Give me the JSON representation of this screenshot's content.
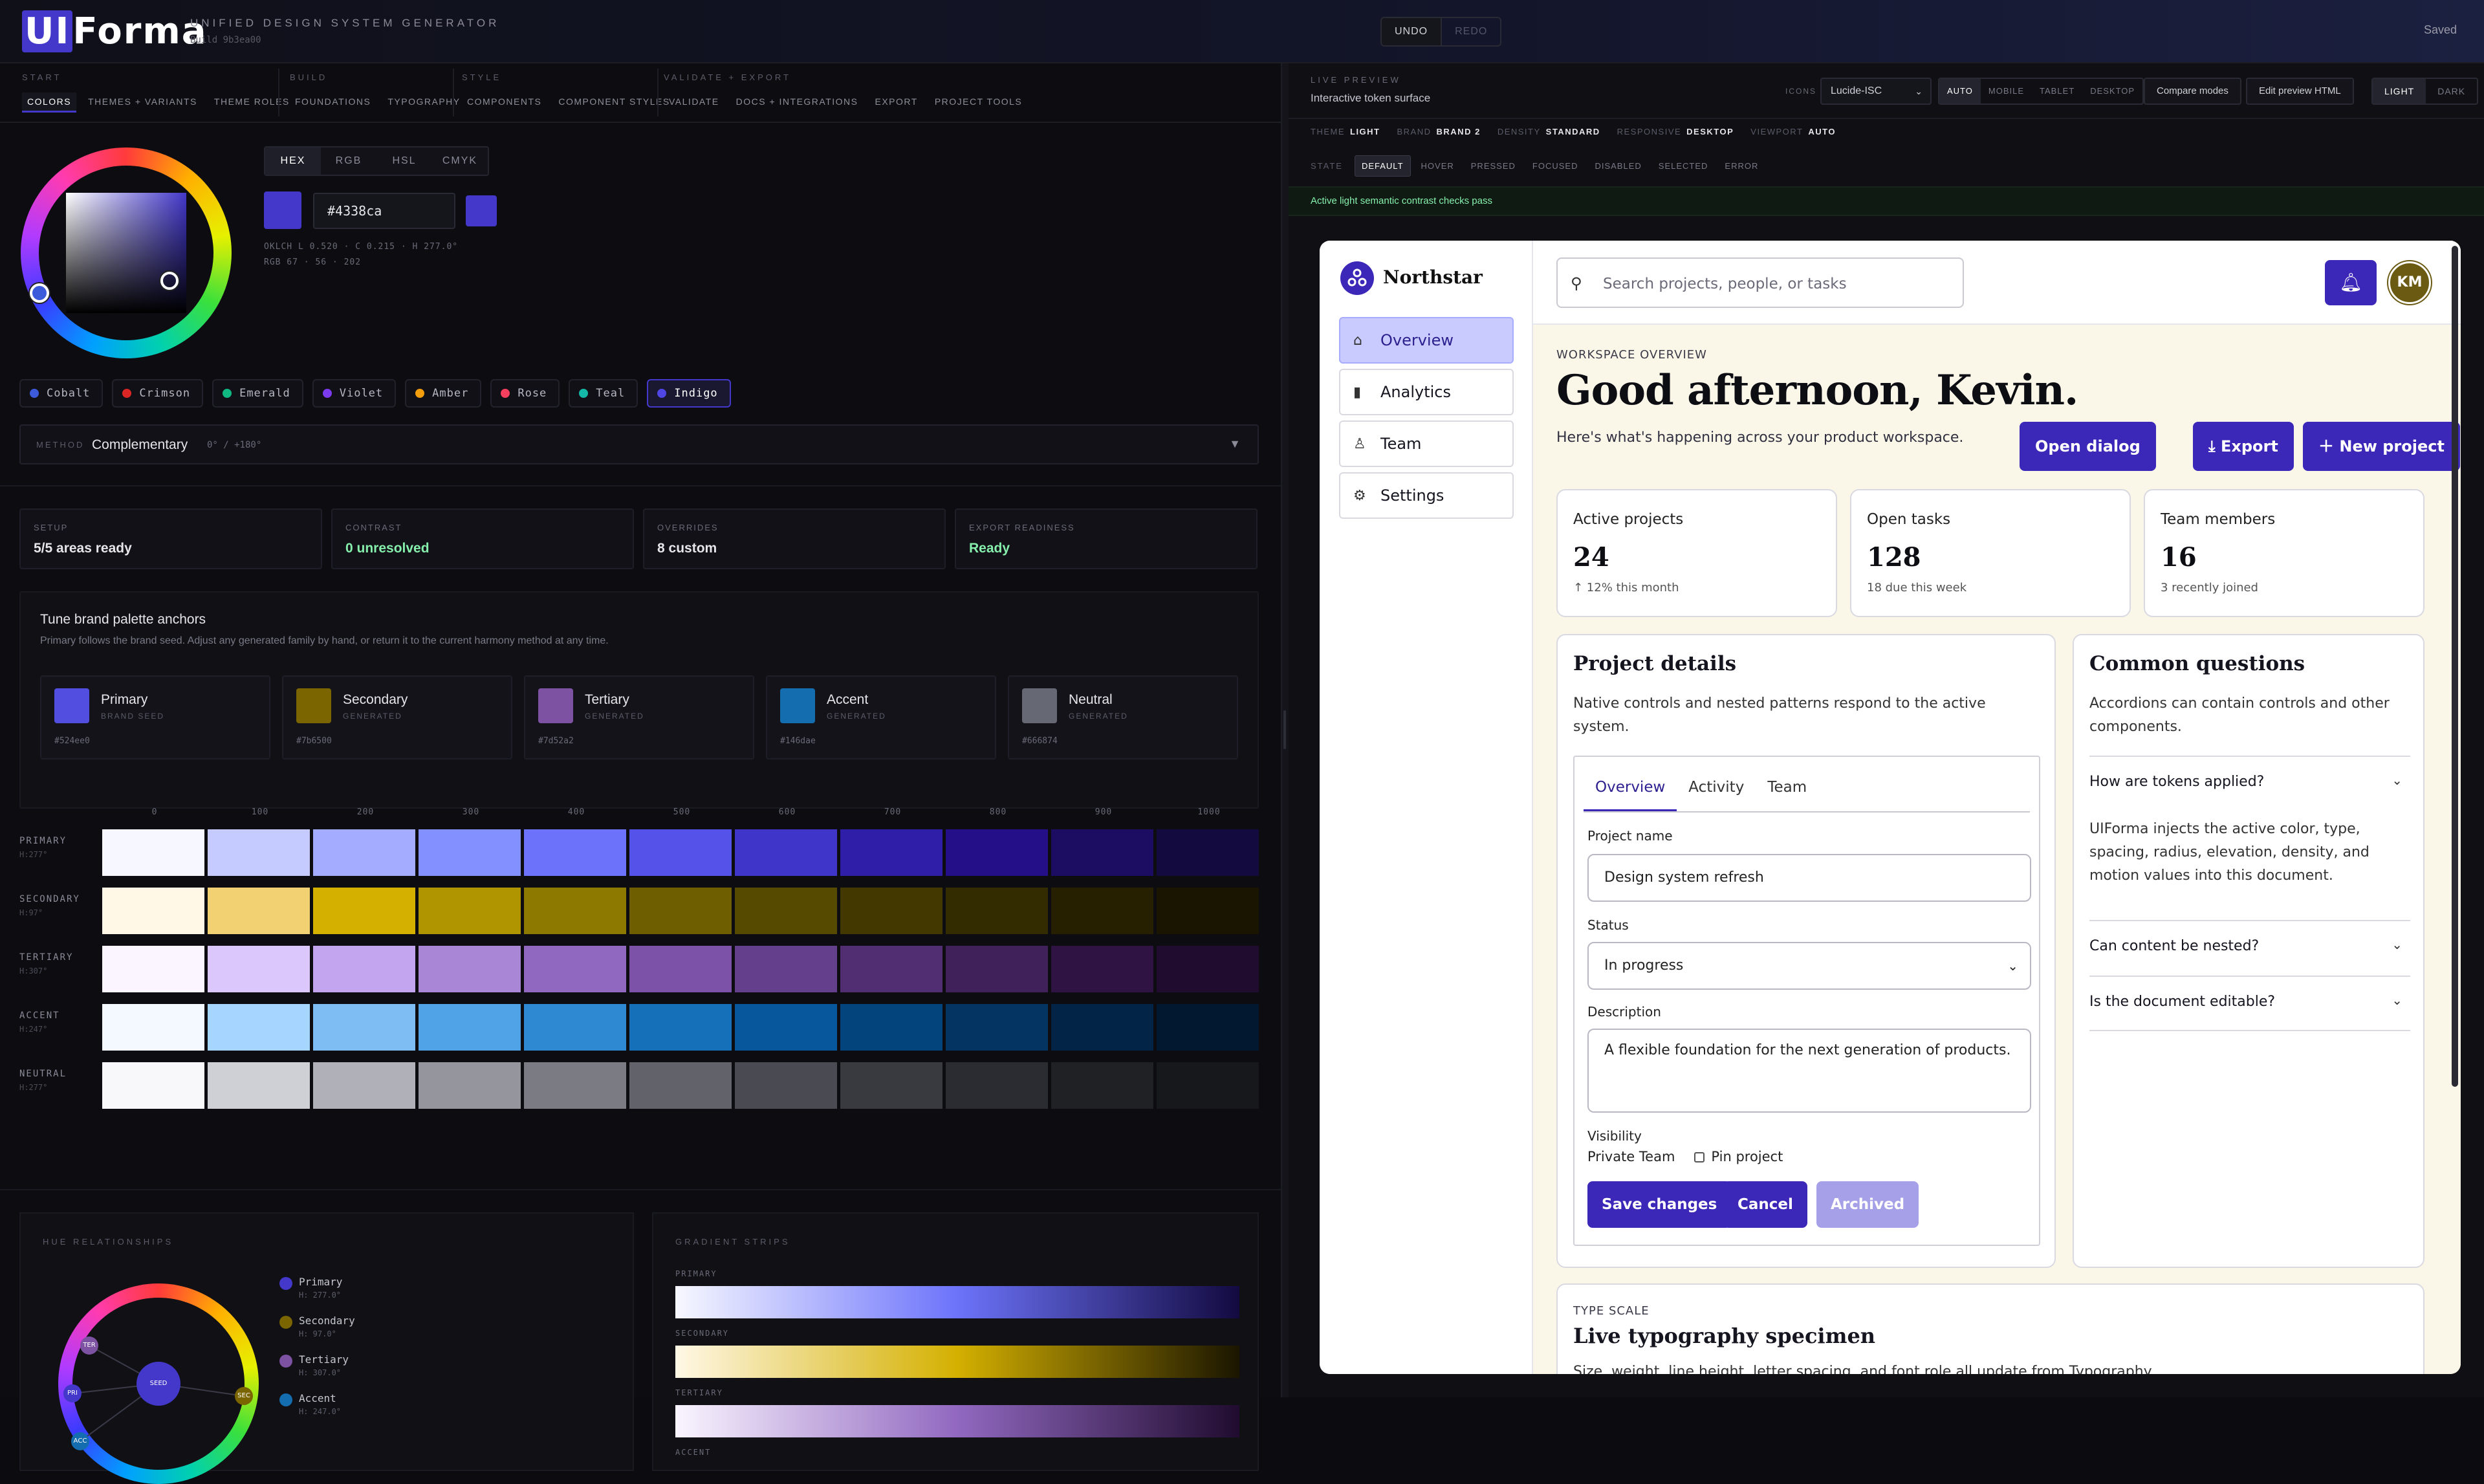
{
  "app": {
    "logo": "UIForma",
    "logo_ui": "UI",
    "logo_rest": "Forma",
    "tagline": "UNIFIED DESIGN SYSTEM GENERATOR",
    "build": "Build 9b3ea00",
    "undo": "UNDO",
    "redo": "REDO",
    "saved": "Saved"
  },
  "nav": {
    "groups": [
      {
        "label": "START",
        "items": [
          "COLORS",
          "THEMES + VARIANTS",
          "THEME ROLES"
        ]
      },
      {
        "label": "BUILD",
        "items": [
          "FOUNDATIONS",
          "TYPOGRAPHY"
        ]
      },
      {
        "label": "STYLE",
        "items": [
          "COMPONENTS",
          "COMPONENT STYLES"
        ]
      },
      {
        "label": "VALIDATE + EXPORT",
        "items": [
          "VALIDATE",
          "DOCS + INTEGRATIONS",
          "EXPORT",
          "PROJECT TOOLS"
        ]
      }
    ],
    "active": "COLORS"
  },
  "picker": {
    "formats": [
      "HEX",
      "RGB",
      "HSL",
      "CMYK"
    ],
    "active_format": "HEX",
    "hex": "#4338ca",
    "oklch": "OKLCH L 0.520 · C 0.215 · H 277.0°",
    "rgb": "RGB 67 · 56 · 202",
    "color": "#4338ca"
  },
  "presets": [
    {
      "name": "Cobalt",
      "color": "#3b5bdb"
    },
    {
      "name": "Crimson",
      "color": "#dc2626"
    },
    {
      "name": "Emerald",
      "color": "#10b981"
    },
    {
      "name": "Violet",
      "color": "#7c3aed"
    },
    {
      "name": "Amber",
      "color": "#f59e0b"
    },
    {
      "name": "Rose",
      "color": "#f43f5e"
    },
    {
      "name": "Teal",
      "color": "#14b8a6"
    },
    {
      "name": "Indigo",
      "color": "#4f46e5"
    }
  ],
  "active_preset": "Indigo",
  "method": {
    "label": "METHOD",
    "value": "Complementary",
    "detail": "0° / +180°"
  },
  "stats": [
    {
      "label": "SETUP",
      "value": "5/5 areas ready",
      "green": false
    },
    {
      "label": "CONTRAST",
      "value": "0 unresolved",
      "green": true
    },
    {
      "label": "OVERRIDES",
      "value": "8 custom",
      "green": false
    },
    {
      "label": "EXPORT READINESS",
      "value": "Ready",
      "green": true
    }
  ],
  "anchors": {
    "title": "Tune brand palette anchors",
    "desc": "Primary follows the brand seed. Adjust any generated family by hand, or return it to the current harmony method at any time.",
    "items": [
      {
        "name": "Primary",
        "kind": "BRAND SEED",
        "hex": "#524ee0",
        "color": "#524ee0"
      },
      {
        "name": "Secondary",
        "kind": "GENERATED",
        "hex": "#7b6500",
        "color": "#7b6500"
      },
      {
        "name": "Tertiary",
        "kind": "GENERATED",
        "hex": "#7d52a2",
        "color": "#7d52a2"
      },
      {
        "name": "Accent",
        "kind": "GENERATED",
        "hex": "#146dae",
        "color": "#146dae"
      },
      {
        "name": "Neutral",
        "kind": "GENERATED",
        "hex": "#666874",
        "color": "#666874"
      }
    ]
  },
  "scale": {
    "steps": [
      "0",
      "100",
      "200",
      "300",
      "400",
      "500",
      "600",
      "700",
      "800",
      "900",
      "1000"
    ],
    "rows": [
      {
        "name": "PRIMARY",
        "hue": "H:277°",
        "colors": [
          "#f7f8ff",
          "#c5cbff",
          "#a3acff",
          "#8390ff",
          "#6c73fa",
          "#5552ea",
          "#3f35c9",
          "#2e1ea8",
          "#250f89",
          "#1c0c62",
          "#130a40"
        ]
      },
      {
        "name": "SECONDARY",
        "hue": "H:97°",
        "colors": [
          "#fff8e6",
          "#f1d171",
          "#d4b000",
          "#b09500",
          "#8d7800",
          "#6f5e00",
          "#564900",
          "#433900",
          "#332c00",
          "#261f00",
          "#1a1500"
        ]
      },
      {
        "name": "TERTIARY",
        "hue": "H:307°",
        "colors": [
          "#faf5ff",
          "#dcc7fd",
          "#c3a4ee",
          "#a987d6",
          "#9168c0",
          "#7c51a8",
          "#643f8b",
          "#512e71",
          "#40215a",
          "#2f1443",
          "#200c2f"
        ]
      },
      {
        "name": "ACCENT",
        "hue": "H:247°",
        "colors": [
          "#f3f9ff",
          "#a6d6ff",
          "#7dbdf3",
          "#50a3e6",
          "#2f88d2",
          "#1670b9",
          "#06579b",
          "#04447d",
          "#033462",
          "#022447",
          "#021830"
        ]
      },
      {
        "name": "NEUTRAL",
        "hue": "H:277°",
        "colors": [
          "#f8f8fa",
          "#cfd0d5",
          "#b0b1b8",
          "#94959d",
          "#7a7b83",
          "#61626a",
          "#4a4b52",
          "#393a40",
          "#2b2c31",
          "#202125",
          "#17181b"
        ]
      }
    ]
  },
  "hue": {
    "title": "HUE RELATIONSHIPS",
    "seed": "SEED",
    "nodes": [
      "TER",
      "PRI",
      "ACC",
      "SEC"
    ],
    "legend": [
      {
        "name": "Primary",
        "h": "H: 277.0°",
        "color": "#4338ca"
      },
      {
        "name": "Secondary",
        "h": "H: 97.0°",
        "color": "#7b6500"
      },
      {
        "name": "Tertiary",
        "h": "H: 307.0°",
        "color": "#7d52a2"
      },
      {
        "name": "Accent",
        "h": "H: 247.0°",
        "color": "#146dae"
      }
    ]
  },
  "gradients": {
    "title": "GRADIENT STRIPS",
    "items": [
      {
        "label": "PRIMARY",
        "from": "#f7f8ff",
        "mid": "#6c73fa",
        "to": "#130a40"
      },
      {
        "label": "SECONDARY",
        "from": "#fff8e6",
        "mid": "#d4b000",
        "to": "#1a1500"
      },
      {
        "label": "TERTIARY",
        "from": "#faf5ff",
        "mid": "#9168c0",
        "to": "#200c2f"
      },
      {
        "label": "ACCENT",
        "from": "",
        "mid": "",
        "to": ""
      }
    ]
  },
  "preview": {
    "label": "LIVE PREVIEW",
    "sub": "Interactive token surface",
    "icons_label": "ICONS",
    "icons_value": "Lucide-ISC",
    "viewports": [
      "AUTO",
      "MOBILE",
      "TABLET",
      "DESKTOP"
    ],
    "active_viewport": "AUTO",
    "compare": "Compare modes",
    "edit": "Edit preview HTML",
    "modes": [
      "LIGHT",
      "DARK"
    ],
    "active_mode": "LIGHT",
    "tokens": [
      {
        "k": "THEME",
        "v": "LIGHT"
      },
      {
        "k": "BRAND",
        "v": "BRAND 2"
      },
      {
        "k": "DENSITY",
        "v": "STANDARD"
      },
      {
        "k": "RESPONSIVE",
        "v": "DESKTOP"
      },
      {
        "k": "VIEWPORT",
        "v": "AUTO"
      }
    ],
    "state_label": "STATE",
    "states": [
      "DEFAULT",
      "HOVER",
      "PRESSED",
      "FOCUSED",
      "DISABLED",
      "SELECTED",
      "ERROR"
    ],
    "active_state": "DEFAULT",
    "contrast": "Active light semantic contrast checks pass"
  },
  "demo": {
    "brand": "Northstar",
    "nav": [
      "Overview",
      "Analytics",
      "Team",
      "Settings"
    ],
    "search_placeholder": "Search projects, people, or tasks",
    "avatar": "KM",
    "eyebrow": "WORKSPACE OVERVIEW",
    "greeting": "Good afternoon, Kevin.",
    "greeting_sub": "Here's what's happening across your product workspace.",
    "buttons": {
      "open": "Open dialog",
      "export": "Export",
      "new": "New project"
    },
    "kpis": [
      {
        "label": "Active projects",
        "value": "24",
        "sub": "↑ 12% this month"
      },
      {
        "label": "Open tasks",
        "value": "128",
        "sub": "18 due this week"
      },
      {
        "label": "Team members",
        "value": "16",
        "sub": "3 recently joined"
      }
    ],
    "details": {
      "title": "Project details",
      "desc": "Native controls and nested patterns respond to the active system.",
      "tabs": [
        "Overview",
        "Activity",
        "Team"
      ],
      "name_label": "Project name",
      "name_value": "Design system refresh",
      "status_label": "Status",
      "status_value": "In progress",
      "desc_label": "Description",
      "desc_value": "A flexible foundation for the next generation of products.",
      "visibility_label": "Visibility",
      "vis_private": "Private",
      "vis_team": "Team",
      "pin": "Pin project",
      "save": "Save changes",
      "cancel": "Cancel",
      "archived": "Archived"
    },
    "faq": {
      "title": "Common questions",
      "desc": "Accordions can contain controls and other components.",
      "q1": "How are tokens applied?",
      "a1": "UIForma injects the active color, type, spacing, radius, elevation, density, and motion values into this document.",
      "q2": "Can content be nested?",
      "q3": "Is the document editable?"
    },
    "type": {
      "eyebrow": "TYPE SCALE",
      "title": "Live typography specimen",
      "desc": "Size, weight, line height, letter spacing, and font role all update from Typography."
    }
  }
}
